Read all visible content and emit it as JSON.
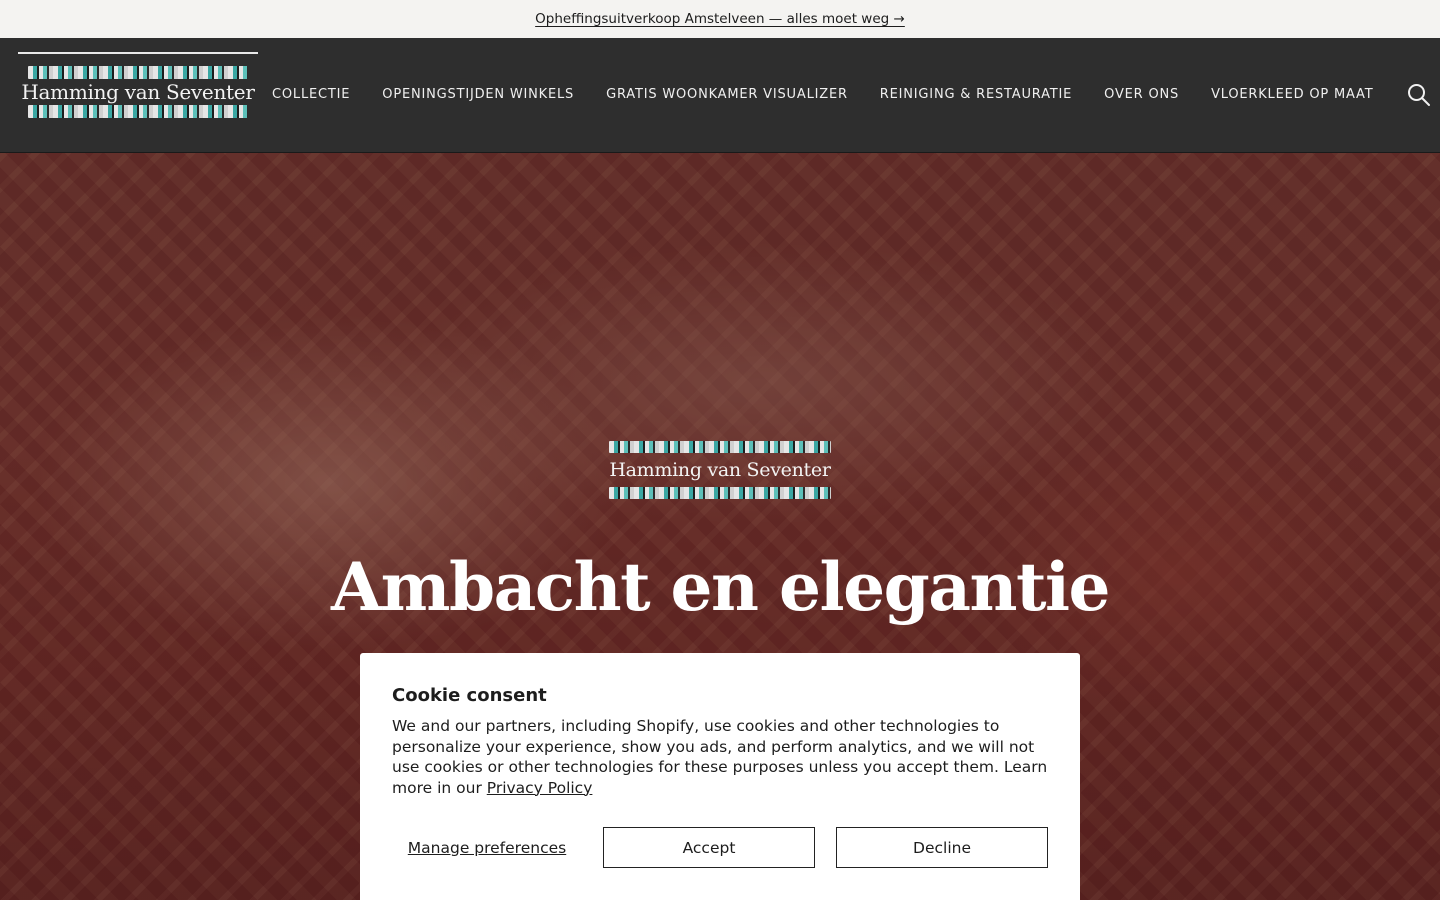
{
  "announcement": {
    "text": "Opheffingsuitverkoop Amstelveen — alles moet weg →"
  },
  "header": {
    "logo_text": "Hamming van Seventer",
    "nav": [
      "COLLECTIE",
      "OPENINGSTIJDEN WINKELS",
      "GRATIS WOONKAMER VISUALIZER",
      "REINIGING & RESTAURATIE",
      "OVER ONS",
      "VLOERKLEED OP MAAT"
    ],
    "search_icon": "search-icon"
  },
  "hero": {
    "logo_text": "Hamming van Seventer",
    "title": "Ambacht en elegantie"
  },
  "cookie": {
    "title": "Cookie consent",
    "body": "We and our partners, including Shopify, use cookies and other technologies to personalize your experience, show you ads, and perform analytics, and we will not use cookies or other technologies for these purposes unless you accept them. Learn more in our ",
    "privacy_link": "Privacy Policy",
    "manage_label": "Manage preferences",
    "accept_label": "Accept",
    "decline_label": "Decline"
  },
  "colors": {
    "header_bg": "#2e2e2e",
    "announcement_bg": "#f4f3f1",
    "logo_accent": "#3aa7a3"
  }
}
